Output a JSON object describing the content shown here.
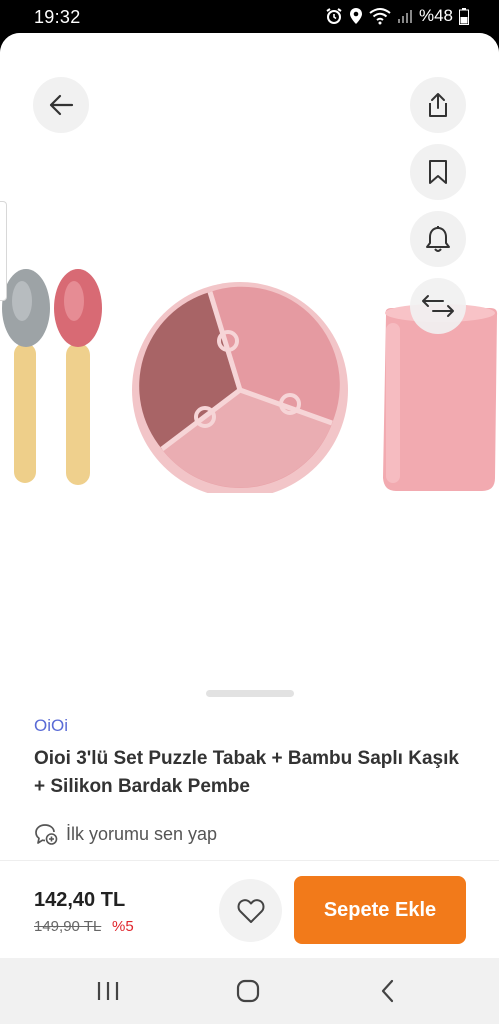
{
  "status_bar": {
    "time": "19:32",
    "battery": "%48",
    "icons": [
      "alarm-icon",
      "location-icon",
      "wifi-icon",
      "signal-icon",
      "battery-icon"
    ]
  },
  "header_actions": {
    "back": "arrow-left-icon",
    "share": "share-icon",
    "bookmark": "bookmark-icon",
    "notify": "bell-icon",
    "compare": "swap-arrows-icon"
  },
  "product": {
    "brand": "OiOi",
    "title": "Oioi 3'lü Set Puzzle Tabak + Bambu Saplı Kaşık + Silikon Bardak Pembe",
    "review_prompt": "İlk yorumu sen yap",
    "price": "142,40 TL",
    "old_price": "149,90 TL",
    "discount": "%5"
  },
  "actions": {
    "add_to_cart": "Sepete Ekle",
    "favorite": "heart-icon"
  },
  "colors": {
    "accent": "#f27a1a",
    "brand": "#5a6bd6",
    "discount": "#e0262d"
  },
  "system_nav": [
    "recent-apps-icon",
    "home-icon",
    "back-icon"
  ]
}
